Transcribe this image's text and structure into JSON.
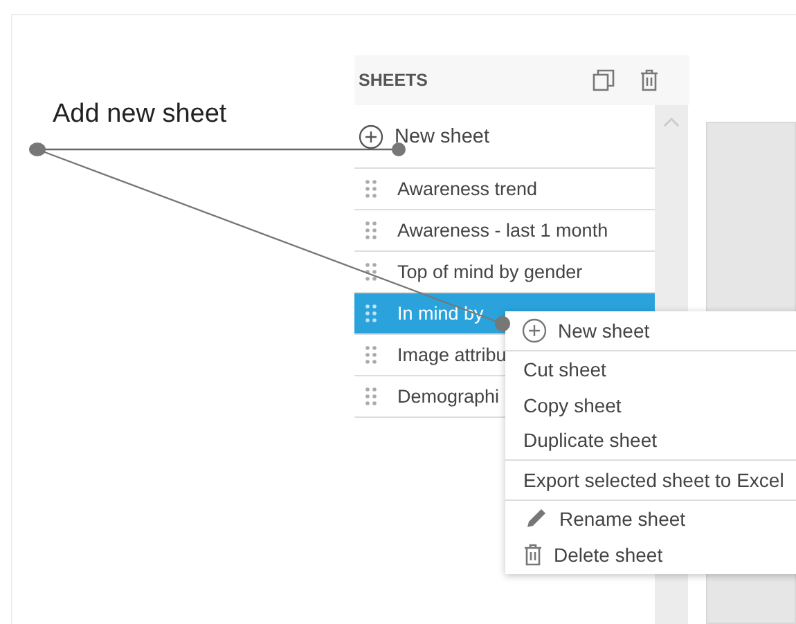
{
  "annotation": {
    "label": "Add new sheet"
  },
  "sidebar": {
    "title": "SHEETS",
    "new_sheet": "New sheet",
    "sheets": [
      {
        "label": "Awareness trend",
        "selected": false
      },
      {
        "label": "Awareness - last 1 month",
        "selected": false
      },
      {
        "label": "Top of mind by gender",
        "selected": false
      },
      {
        "label": "In mind by",
        "selected": true
      },
      {
        "label": "Image attribu",
        "selected": false
      },
      {
        "label": "Demographi",
        "selected": false
      }
    ]
  },
  "context_menu": {
    "groups": [
      [
        {
          "label": "New sheet",
          "kind": "plus"
        }
      ],
      [
        {
          "label": "Cut sheet",
          "kind": "plain"
        },
        {
          "label": "Copy sheet",
          "kind": "plain"
        },
        {
          "label": "Duplicate sheet",
          "kind": "plain"
        }
      ],
      [
        {
          "label": "Export selected sheet to Excel",
          "kind": "plain"
        }
      ],
      [
        {
          "label": "Rename sheet",
          "kind": "pencil"
        },
        {
          "label": "Delete sheet",
          "kind": "trash"
        }
      ]
    ]
  }
}
